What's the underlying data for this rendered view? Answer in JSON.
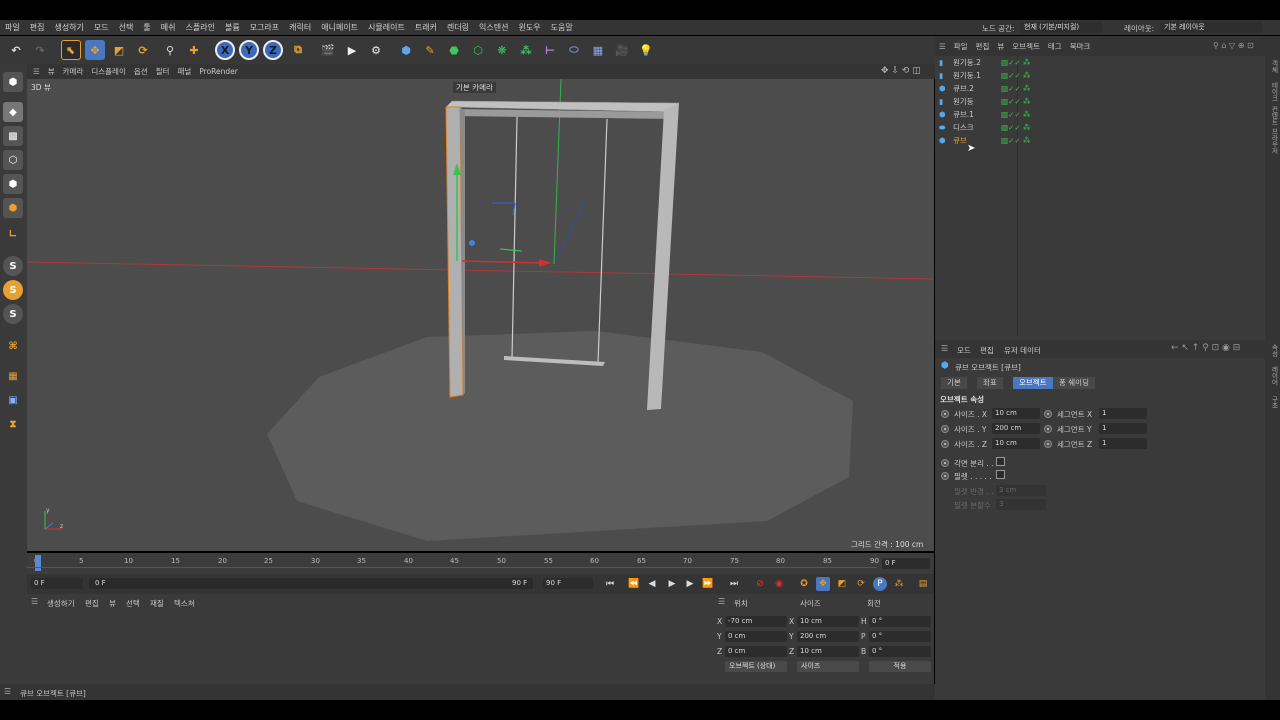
{
  "menu": {
    "items": [
      "파일",
      "편집",
      "생성하기",
      "모드",
      "선택",
      "툴",
      "메쉬",
      "스플라인",
      "볼륨",
      "모그라프",
      "캐릭터",
      "애니메이트",
      "시뮬레이트",
      "트래커",
      "렌더링",
      "익스텐션",
      "윈도우",
      "도움말"
    ],
    "node_space_label": "노드 공간:",
    "node_space_value": "현재 (기본/피지컬)",
    "layout_label": "레이아웃:",
    "layout_value": "기본 레이아웃"
  },
  "toolbar": {
    "axis_x": "X",
    "axis_y": "Y",
    "axis_z": "Z"
  },
  "lefttools": {
    "s1": "S",
    "s2": "S",
    "s3": "S"
  },
  "viewport_menu": {
    "items": [
      "뷰",
      "카메라",
      "디스플레이",
      "옵션",
      "필터",
      "패널",
      "ProRender"
    ]
  },
  "viewport": {
    "view_label": "3D 뷰",
    "camera_label": "기본 카메라",
    "grid_label": "그리드 간격 : 100 cm",
    "axis_y": "y",
    "axis_z": "z"
  },
  "timeline": {
    "ticks": [
      "0",
      "5",
      "10",
      "15",
      "20",
      "25",
      "30",
      "35",
      "40",
      "45",
      "50",
      "55",
      "60",
      "65",
      "70",
      "75",
      "80",
      "85",
      "90"
    ],
    "current_frame": "0 F"
  },
  "transport": {
    "start": "0 F",
    "range_start": "0 F",
    "range_end": "90 F",
    "end": "90 F"
  },
  "materials": {
    "menu": [
      "생성하기",
      "편집",
      "뷰",
      "선택",
      "재질",
      "텍스쳐"
    ]
  },
  "coords": {
    "headers": [
      "위치",
      "사이즈",
      "회전"
    ],
    "pos": {
      "x": "-70 cm",
      "y": "0 cm",
      "z": "0 cm"
    },
    "size": {
      "x": "10 cm",
      "y": "200 cm",
      "z": "10 cm"
    },
    "rot": {
      "h": "0 °",
      "p": "0 °",
      "b": "0 °"
    },
    "labels": {
      "x": "X",
      "y": "Y",
      "z": "Z",
      "h": "H",
      "p": "P",
      "b": "B"
    },
    "mode_dropdown": "오브젝트 (상대)",
    "size_dropdown": "사이즈",
    "apply_button": "적용"
  },
  "status": {
    "text": "큐브 오브젝트 [큐브]"
  },
  "objects": {
    "menu": [
      "파일",
      "편집",
      "뷰",
      "오브젝트",
      "태그",
      "북마크"
    ],
    "items": [
      {
        "name": "원기둥.2",
        "icon": "cylinder-icon"
      },
      {
        "name": "원기둥.1",
        "icon": "cylinder-icon"
      },
      {
        "name": "큐브.2",
        "icon": "cube-icon"
      },
      {
        "name": "원기둥",
        "icon": "cylinder-icon"
      },
      {
        "name": "큐브.1",
        "icon": "cube-icon"
      },
      {
        "name": "디스크",
        "icon": "disc-icon"
      },
      {
        "name": "큐브",
        "icon": "cube-icon"
      }
    ]
  },
  "side_tabs": {
    "a": "객체",
    "b": "테이크",
    "c": "컨텐트 브라우저",
    "d": "속성",
    "e": "레이어",
    "f": "구조"
  },
  "attributes": {
    "menu": [
      "모드",
      "편집",
      "유저 데이터"
    ],
    "title": "큐브 오브젝트 [큐브]",
    "tabs": [
      "기본",
      "좌표",
      "오브젝트",
      "퐁 쉐이딩"
    ],
    "section": "오브젝트 속성",
    "size_x_label": "사이즈 . X",
    "size_x": "10 cm",
    "size_y_label": "사이즈 . Y",
    "size_y": "200 cm",
    "size_z_label": "사이즈 . Z",
    "size_z": "10 cm",
    "seg_x_label": "세그먼트 X",
    "seg_x": "1",
    "seg_y_label": "세그먼트 Y",
    "seg_y": "1",
    "seg_z_label": "세그먼트 Z",
    "seg_z": "1",
    "separate_label": "각면 분리 . .",
    "fillet_label": "필렛 . . . . .",
    "fillet_radius_label": "필렛 반경 . .",
    "fillet_radius": "3 cm",
    "fillet_sub_label": "필렛 분할수",
    "fillet_sub": "3"
  },
  "colors": {
    "accent": "#4a78c0",
    "orange": "#e8a030",
    "bg": "#4c4c4c"
  }
}
